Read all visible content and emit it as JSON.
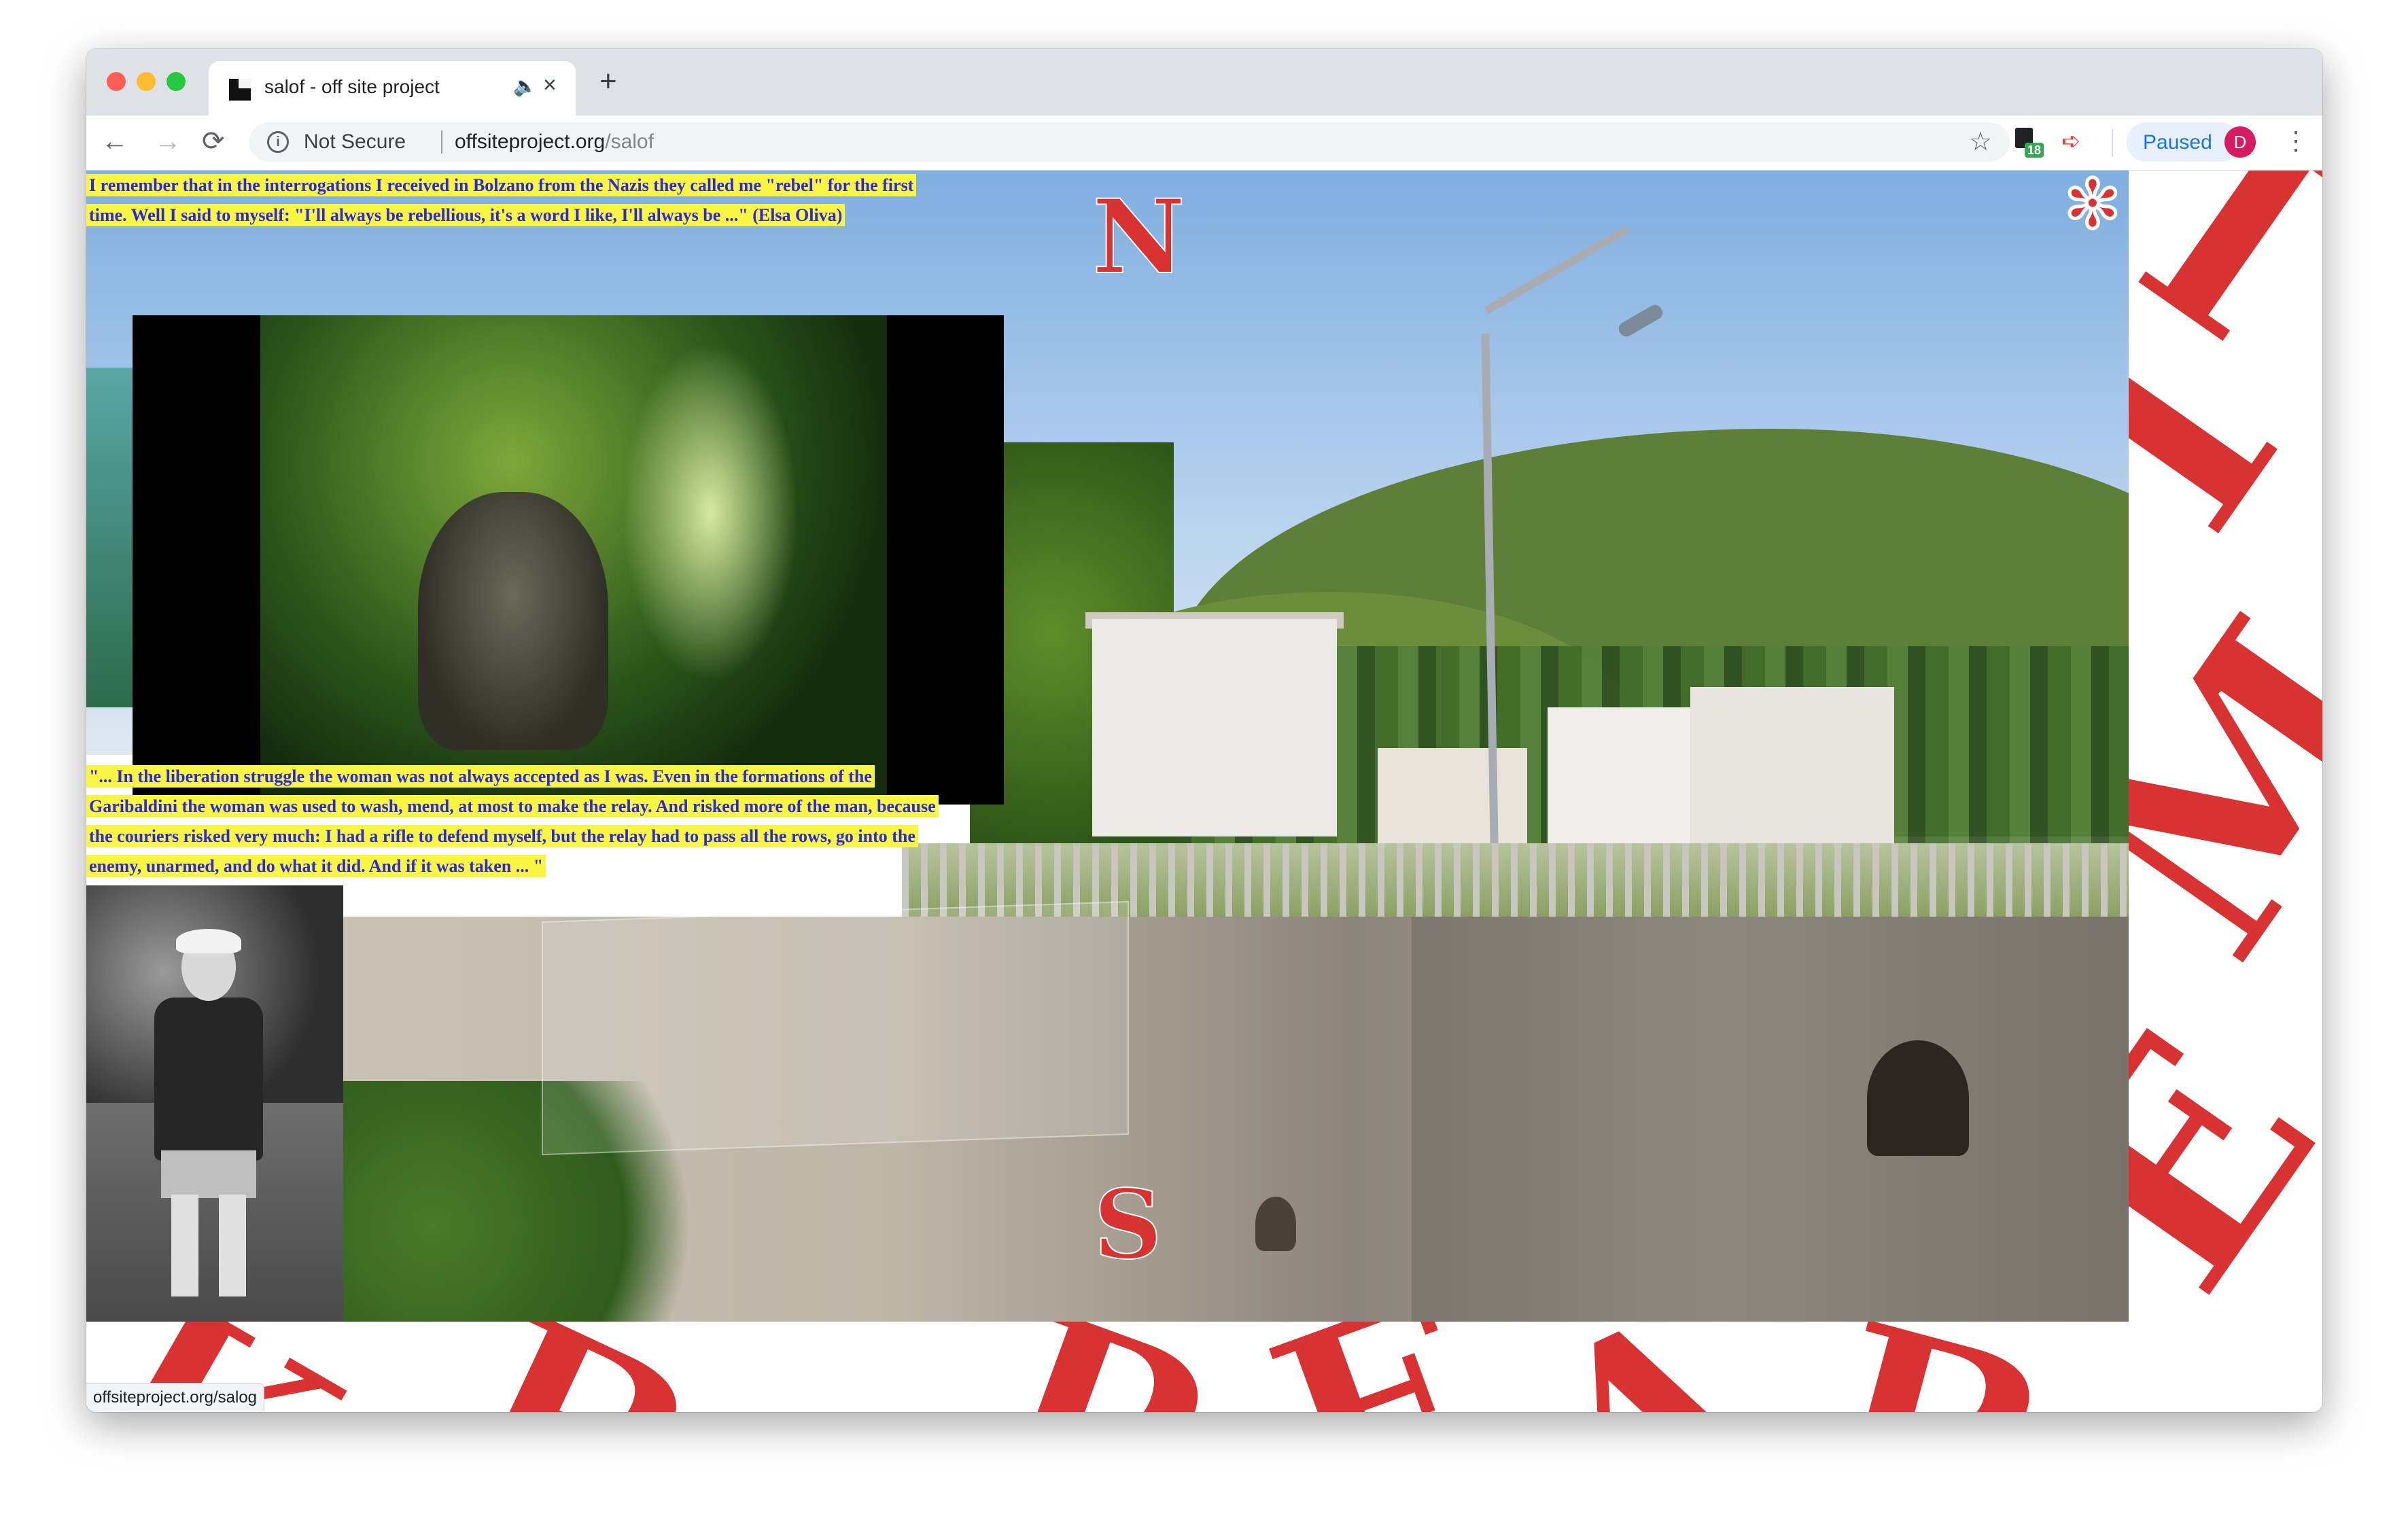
{
  "browser": {
    "tab_title": "salof - off site project",
    "address_security": "Not Secure",
    "url_host": "offsiteproject.org",
    "url_path": "/salof",
    "extension_badge": "18",
    "profile_status": "Paused",
    "profile_initial": "D",
    "status_bar_url": "offsiteproject.org/salog"
  },
  "content": {
    "quote_top": "I remember that in the interrogations I received in Bolzano from the Nazis they called me \"rebel\" for the first time. Well I said to myself: \"I'll always be rebellious, it's a word I like, I'll always be ...\" (Elsa Oliva)",
    "quote_bottom": "\"... In the liberation struggle the woman was not always accepted as I was. Even in the formations of the Garibaldini the woman was used to wash, mend, at most to make the relay. And risked more of the man, because the couriers risked very much: I had a rifle to defend myself, but the relay had to pass all the rows, go into the enemy, unarmed, and do what it did. And if it was taken ... \"",
    "compass_north": "N",
    "compass_south": "S",
    "compass_star": "✻"
  },
  "icons": {
    "back": "←",
    "forward": "→",
    "reload": "⟳",
    "info": "i",
    "star": "☆",
    "audio": "🔈",
    "close": "×",
    "new_tab": "+",
    "menu": "⋮"
  },
  "colors": {
    "accent_red": "#d93232",
    "quote_highlight": "#f9f544",
    "quote_text": "#2b2ad6"
  }
}
